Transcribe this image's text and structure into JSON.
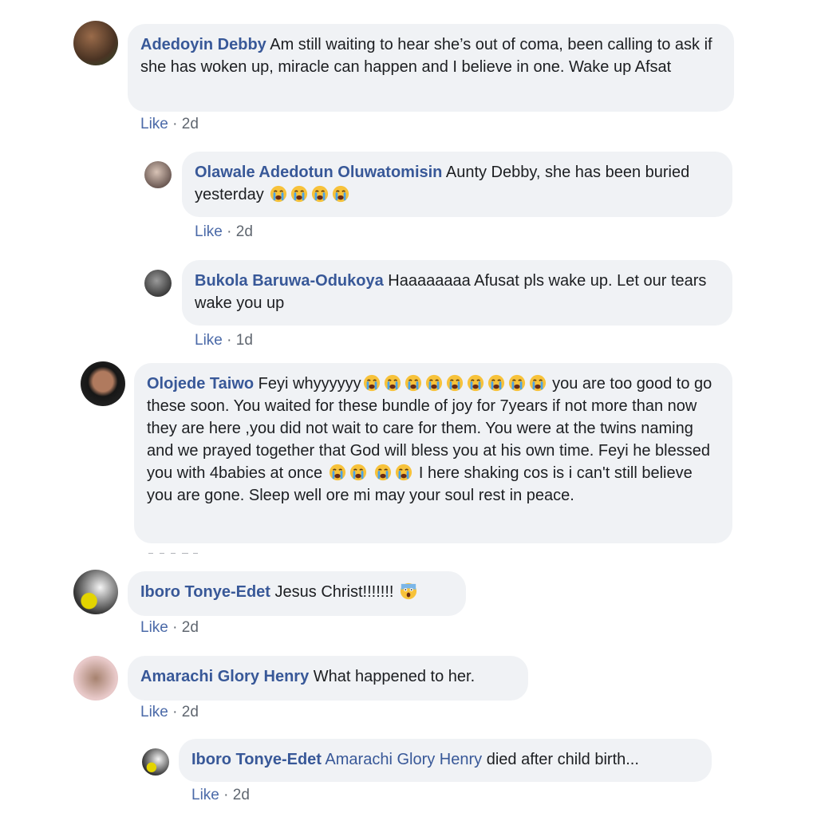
{
  "comments": [
    {
      "author": "Adedoyin Debby",
      "text": "Am still waiting to hear she’s out of coma, been calling to ask if she has woken up, miracle can happen and I believe in one. Wake up Afsat",
      "like": "Like",
      "time": "2d"
    },
    {
      "author": "Olawale Adedotun Oluwatomisin",
      "text": "Aunty Debby, she has been buried yesterday",
      "like": "Like",
      "time": "2d",
      "emoji": "crying-face"
    },
    {
      "author": "Bukola Baruwa-Odukoya",
      "text": "Haaaaaaaa Afusat pls wake up. Let our tears wake you up",
      "like": "Like",
      "time": "1d"
    },
    {
      "author": "Olojede Taiwo",
      "text_a": "Feyi whyyyyyy",
      "text_b": "you are too good to go these soon. You waited for these bundle of joy for 7years if not more than now they are here ,you did not wait to care for them. You were at the twins naming and we prayed together that God will bless you at his own time. Feyi he blessed you with 4babies at once",
      "text_c": "I here shaking cos is i can't still believe you are gone. Sleep well ore mi may your soul rest in peace.",
      "emoji": "crying-face"
    },
    {
      "author": "Iboro Tonye-Edet",
      "text": "Jesus Christ!!!!!!!",
      "like": "Like",
      "time": "2d",
      "emoji": "screaming-face"
    },
    {
      "author": "Amarachi Glory Henry",
      "text": "What happened to her.",
      "like": "Like",
      "time": "2d"
    },
    {
      "author": "Iboro Tonye-Edet",
      "mention": "Amarachi Glory Henry",
      "text": "died after child birth...",
      "like": "Like",
      "time": "2d"
    }
  ],
  "colors": {
    "name": "#385898",
    "bubble": "#f0f2f5",
    "meta": "#606770"
  }
}
